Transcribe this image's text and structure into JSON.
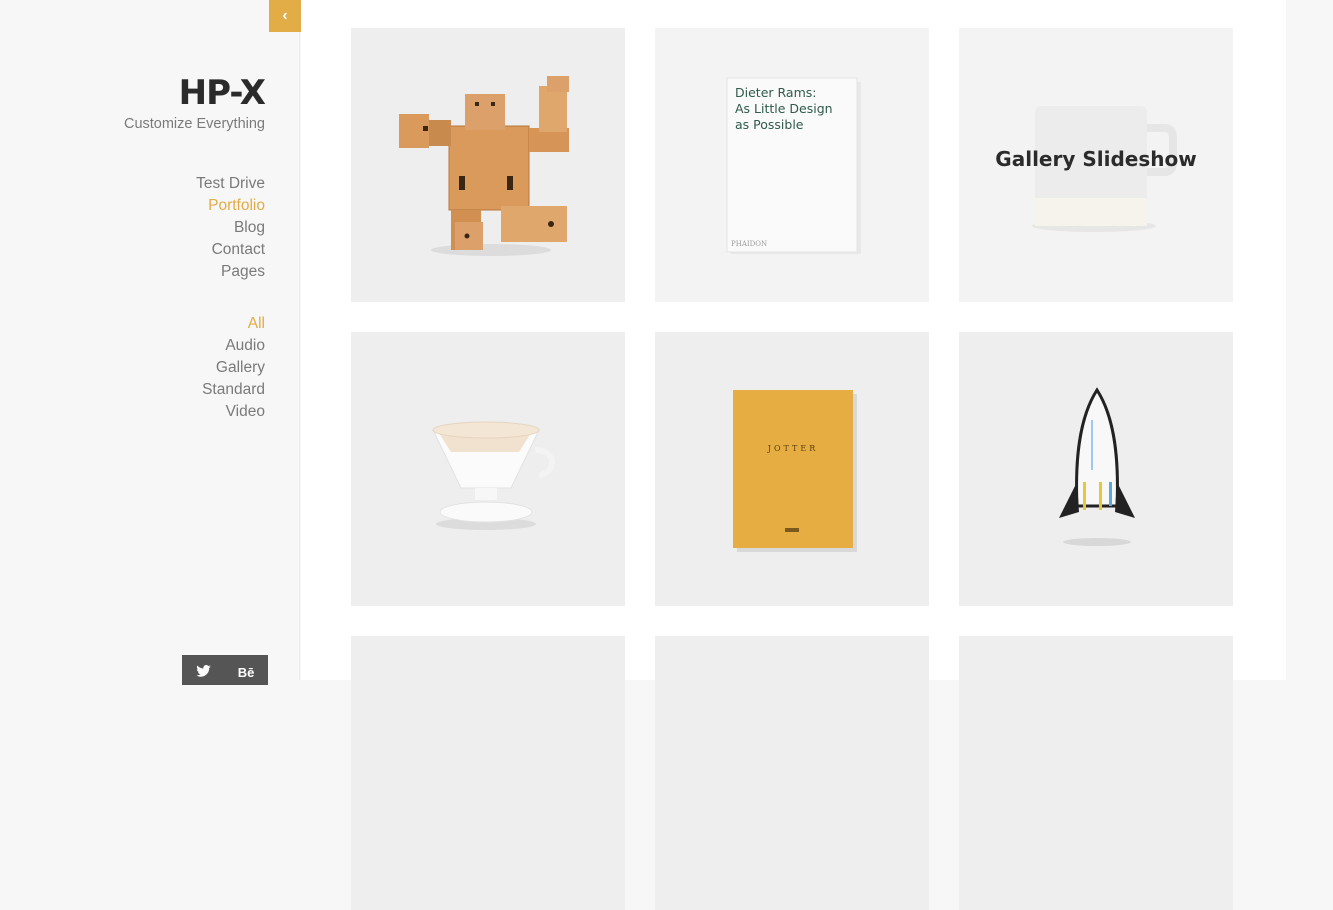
{
  "brand": {
    "title": "HP-X",
    "tagline": "Customize Everything"
  },
  "nav": {
    "items": [
      {
        "label": "Test Drive",
        "active": false
      },
      {
        "label": "Portfolio",
        "active": true
      },
      {
        "label": "Blog",
        "active": false
      },
      {
        "label": "Contact",
        "active": false
      },
      {
        "label": "Pages",
        "active": false
      }
    ]
  },
  "filters": {
    "items": [
      {
        "label": "All",
        "active": true
      },
      {
        "label": "Audio",
        "active": false
      },
      {
        "label": "Gallery",
        "active": false
      },
      {
        "label": "Standard",
        "active": false
      },
      {
        "label": "Video",
        "active": false
      }
    ]
  },
  "social": {
    "twitter_icon": "twitter-icon",
    "behance_label": "Bē"
  },
  "collapse": {
    "icon": "‹"
  },
  "colors": {
    "accent": "#e2ac46",
    "text": "#7a7a7a",
    "brand": "#2b2b2b"
  },
  "portfolio": {
    "items": [
      {
        "name": "wooden-robot",
        "overlay": ""
      },
      {
        "name": "dieter-rams-book",
        "overlay": "",
        "book_title_lines": [
          "Dieter Rams:",
          "As Little Design",
          "as Possible"
        ],
        "publisher": "PHAIDON"
      },
      {
        "name": "mug",
        "overlay": "Gallery Slideshow"
      },
      {
        "name": "coffee-dripper",
        "overlay": ""
      },
      {
        "name": "jotter-notebook",
        "overlay": "",
        "cover_text": "JOTTER"
      },
      {
        "name": "rocket",
        "overlay": ""
      }
    ]
  }
}
